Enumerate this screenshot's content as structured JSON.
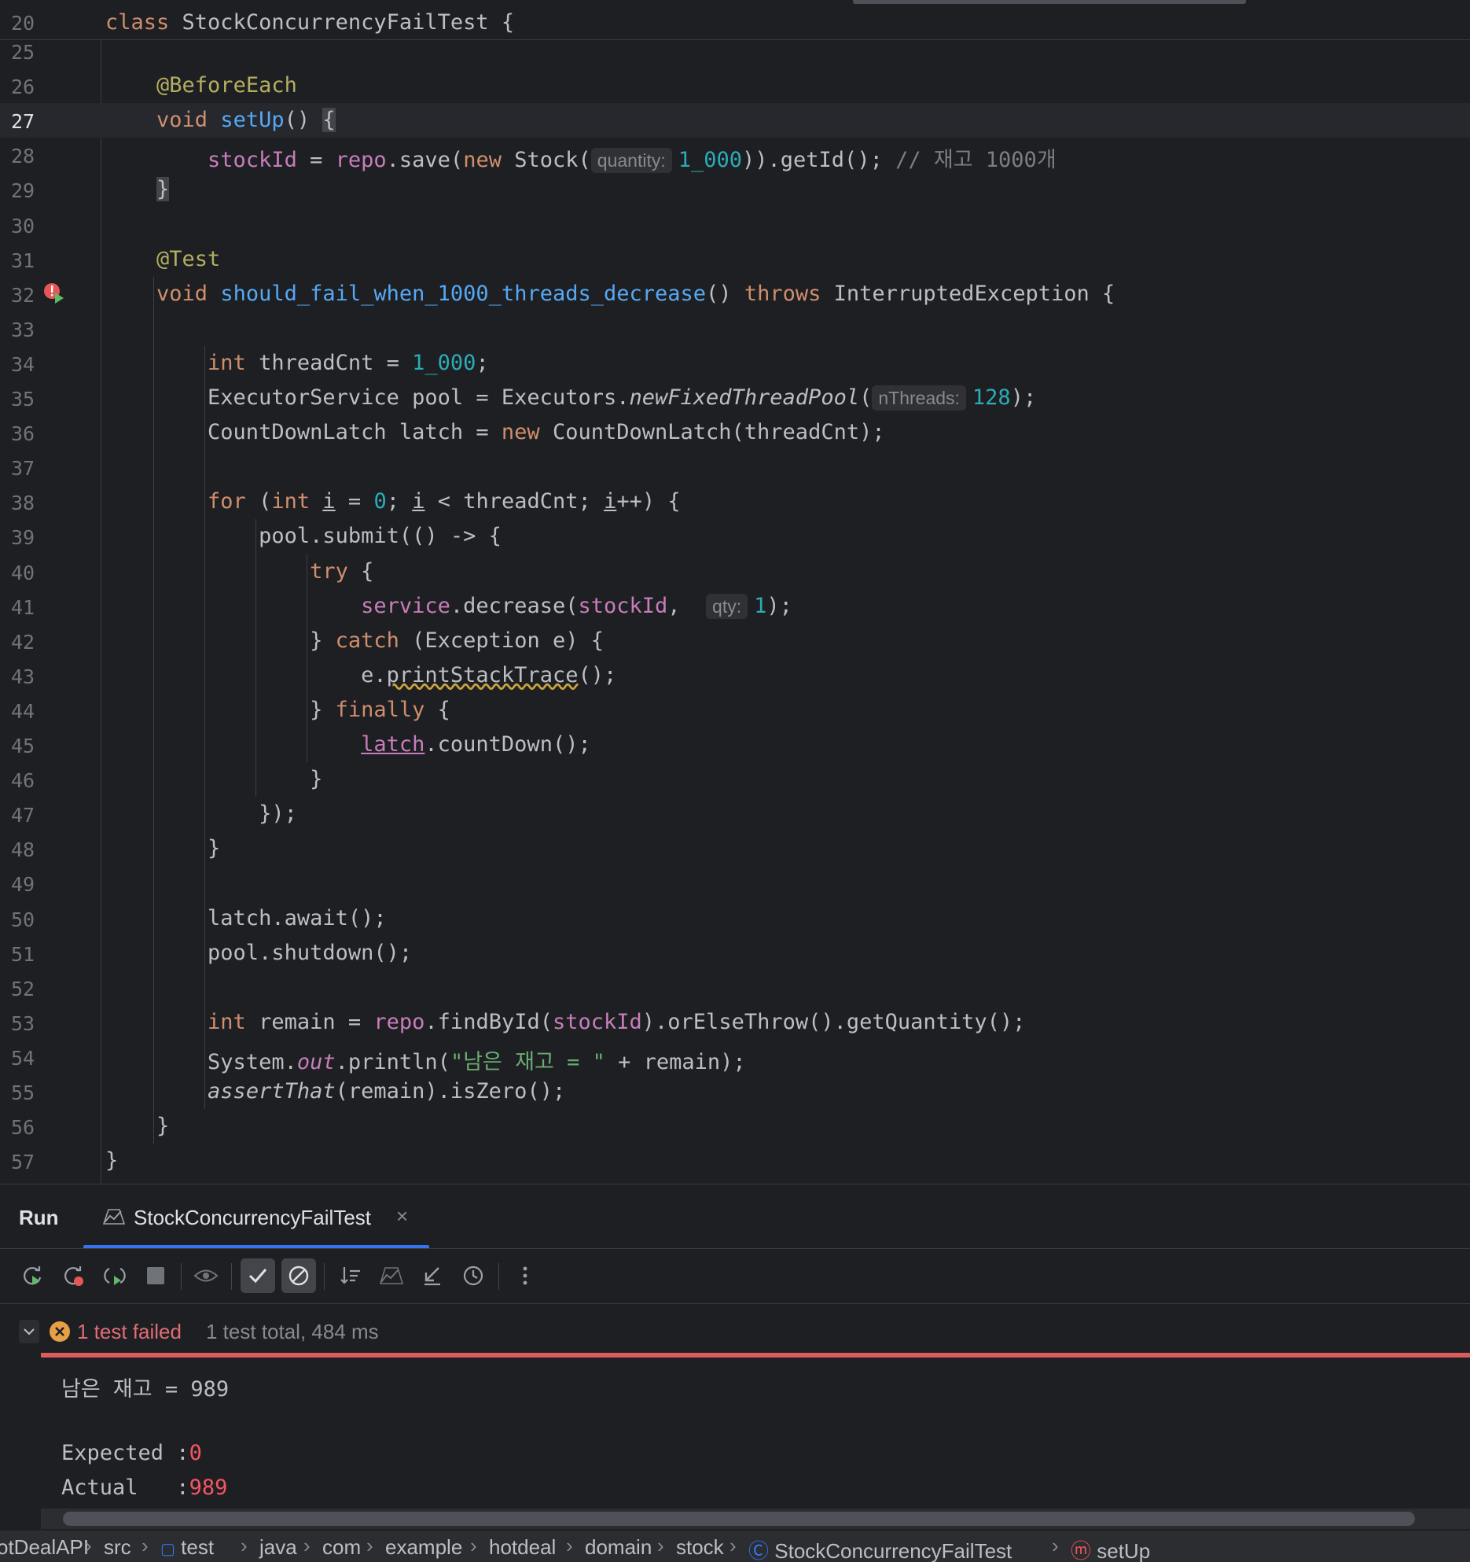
{
  "sticky_header": {
    "line_no": "20",
    "keyword": "class",
    "name": " StockConcurrencyFailTest {"
  },
  "lines": [
    {
      "no": "25"
    },
    {
      "no": "26",
      "tokens": [
        {
          "t": "    "
        },
        {
          "t": "@BeforeEach",
          "c": "ann"
        }
      ]
    },
    {
      "no": "27",
      "current": true,
      "tokens": [
        {
          "t": "    "
        },
        {
          "t": "void",
          "c": "kw"
        },
        {
          "t": " "
        },
        {
          "t": "setUp",
          "c": "fn"
        },
        {
          "t": "() "
        },
        {
          "t": "{",
          "c": "brace-hl"
        }
      ]
    },
    {
      "no": "28",
      "tokens": [
        {
          "t": "        "
        },
        {
          "t": "stockId",
          "c": "fld"
        },
        {
          "t": " = "
        },
        {
          "t": "repo",
          "c": "fld"
        },
        {
          "t": ".save("
        },
        {
          "t": "new",
          "c": "kw"
        },
        {
          "t": " Stock("
        },
        {
          "t": "quantity:",
          "c": "hint"
        },
        {
          "t": "1_000",
          "c": "num"
        },
        {
          "t": ")).getId(); "
        },
        {
          "t": "// 재고 1000개",
          "c": "cmt"
        }
      ]
    },
    {
      "no": "29",
      "tokens": [
        {
          "t": "    "
        },
        {
          "t": "}",
          "c": "brace-hl"
        }
      ]
    },
    {
      "no": "30"
    },
    {
      "no": "31",
      "tokens": [
        {
          "t": "    "
        },
        {
          "t": "@Test",
          "c": "ann"
        }
      ]
    },
    {
      "no": "32",
      "icon": true,
      "tokens": [
        {
          "t": "    "
        },
        {
          "t": "void",
          "c": "kw"
        },
        {
          "t": " "
        },
        {
          "t": "should_fail_when_1000_threads_decrease",
          "c": "fn"
        },
        {
          "t": "() "
        },
        {
          "t": "throws",
          "c": "kw"
        },
        {
          "t": " InterruptedException {"
        }
      ]
    },
    {
      "no": "33"
    },
    {
      "no": "34",
      "tokens": [
        {
          "t": "        "
        },
        {
          "t": "int",
          "c": "kw"
        },
        {
          "t": " threadCnt = "
        },
        {
          "t": "1_000",
          "c": "num"
        },
        {
          "t": ";"
        }
      ]
    },
    {
      "no": "35",
      "tokens": [
        {
          "t": "        ExecutorService pool = Executors."
        },
        {
          "t": "newFixedThreadPool",
          "c": "it"
        },
        {
          "t": "("
        },
        {
          "t": "nThreads:",
          "c": "hint"
        },
        {
          "t": "128",
          "c": "num"
        },
        {
          "t": ");"
        }
      ]
    },
    {
      "no": "36",
      "tokens": [
        {
          "t": "        CountDownLatch latch = "
        },
        {
          "t": "new",
          "c": "kw"
        },
        {
          "t": " CountDownLatch(threadCnt);"
        }
      ]
    },
    {
      "no": "37"
    },
    {
      "no": "38",
      "tokens": [
        {
          "t": "        "
        },
        {
          "t": "for",
          "c": "kw"
        },
        {
          "t": " ("
        },
        {
          "t": "int",
          "c": "kw"
        },
        {
          "t": " "
        },
        {
          "t": "i",
          "c": "ul"
        },
        {
          "t": " = "
        },
        {
          "t": "0",
          "c": "num"
        },
        {
          "t": "; "
        },
        {
          "t": "i",
          "c": "ul"
        },
        {
          "t": " < threadCnt; "
        },
        {
          "t": "i",
          "c": "ul"
        },
        {
          "t": "++) {"
        }
      ]
    },
    {
      "no": "39",
      "tokens": [
        {
          "t": "            pool.submit(() -> {"
        }
      ]
    },
    {
      "no": "40",
      "tokens": [
        {
          "t": "                "
        },
        {
          "t": "try",
          "c": "kw"
        },
        {
          "t": " {"
        }
      ]
    },
    {
      "no": "41",
      "tokens": [
        {
          "t": "                    "
        },
        {
          "t": "service",
          "c": "fld"
        },
        {
          "t": ".decrease("
        },
        {
          "t": "stockId",
          "c": "fld"
        },
        {
          "t": ",  "
        },
        {
          "t": "qty:",
          "c": "hint"
        },
        {
          "t": "1",
          "c": "num"
        },
        {
          "t": ");"
        }
      ]
    },
    {
      "no": "42",
      "tokens": [
        {
          "t": "                } "
        },
        {
          "t": "catch",
          "c": "kw"
        },
        {
          "t": " (Exception e) {"
        }
      ]
    },
    {
      "no": "43",
      "tokens": [
        {
          "t": "                    e."
        },
        {
          "t": "printStackTrace",
          "c": "squig"
        },
        {
          "t": "();"
        }
      ]
    },
    {
      "no": "44",
      "tokens": [
        {
          "t": "                } "
        },
        {
          "t": "finally",
          "c": "kw"
        },
        {
          "t": " {"
        }
      ]
    },
    {
      "no": "45",
      "tokens": [
        {
          "t": "                    "
        },
        {
          "t": "latch",
          "c": "fld ul"
        },
        {
          "t": ".countDown();"
        }
      ]
    },
    {
      "no": "46",
      "tokens": [
        {
          "t": "                }"
        }
      ]
    },
    {
      "no": "47",
      "tokens": [
        {
          "t": "            });"
        }
      ]
    },
    {
      "no": "48",
      "tokens": [
        {
          "t": "        }"
        }
      ]
    },
    {
      "no": "49"
    },
    {
      "no": "50",
      "tokens": [
        {
          "t": "        latch.await();"
        }
      ]
    },
    {
      "no": "51",
      "tokens": [
        {
          "t": "        pool.shutdown();"
        }
      ]
    },
    {
      "no": "52"
    },
    {
      "no": "53",
      "tokens": [
        {
          "t": "        "
        },
        {
          "t": "int",
          "c": "kw"
        },
        {
          "t": " remain = "
        },
        {
          "t": "repo",
          "c": "fld"
        },
        {
          "t": ".findById("
        },
        {
          "t": "stockId",
          "c": "fld"
        },
        {
          "t": ").orElseThrow().getQuantity();"
        }
      ]
    },
    {
      "no": "54",
      "tokens": [
        {
          "t": "        System."
        },
        {
          "t": "out",
          "c": "fld it"
        },
        {
          "t": ".println("
        },
        {
          "t": "\"남은 재고 = \"",
          "c": "str"
        },
        {
          "t": " + remain);"
        }
      ]
    },
    {
      "no": "55",
      "tokens": [
        {
          "t": "        "
        },
        {
          "t": "assertThat",
          "c": "it"
        },
        {
          "t": "(remain).isZero();"
        }
      ]
    },
    {
      "no": "56",
      "tokens": [
        {
          "t": "    }"
        }
      ]
    },
    {
      "no": "57",
      "tokens": [
        {
          "t": "}"
        }
      ]
    }
  ],
  "run_panel": {
    "title": "Run",
    "tab_label": "StockConcurrencyFailTest",
    "tab_close": "×",
    "status_failed": "1 test failed",
    "status_total": "1 test total, 484 ms",
    "console": {
      "output_line": "남은 재고 = 989",
      "expected_label": "Expected :",
      "expected_value": "0",
      "actual_label": "Actual   :",
      "actual_value": "989"
    }
  },
  "breadcrumbs": [
    "otDealAPI",
    "src",
    "test",
    "java",
    "com",
    "example",
    "hotdeal",
    "domain",
    "stock",
    "StockConcurrencyFailTest",
    "setUp"
  ],
  "colors": {
    "background": "#1e1f22",
    "keyword": "#cf8e6d",
    "function": "#56a8f5",
    "field": "#c77dbb",
    "number": "#2aacb8",
    "fail": "#db5c5c",
    "accent": "#3574f0"
  }
}
